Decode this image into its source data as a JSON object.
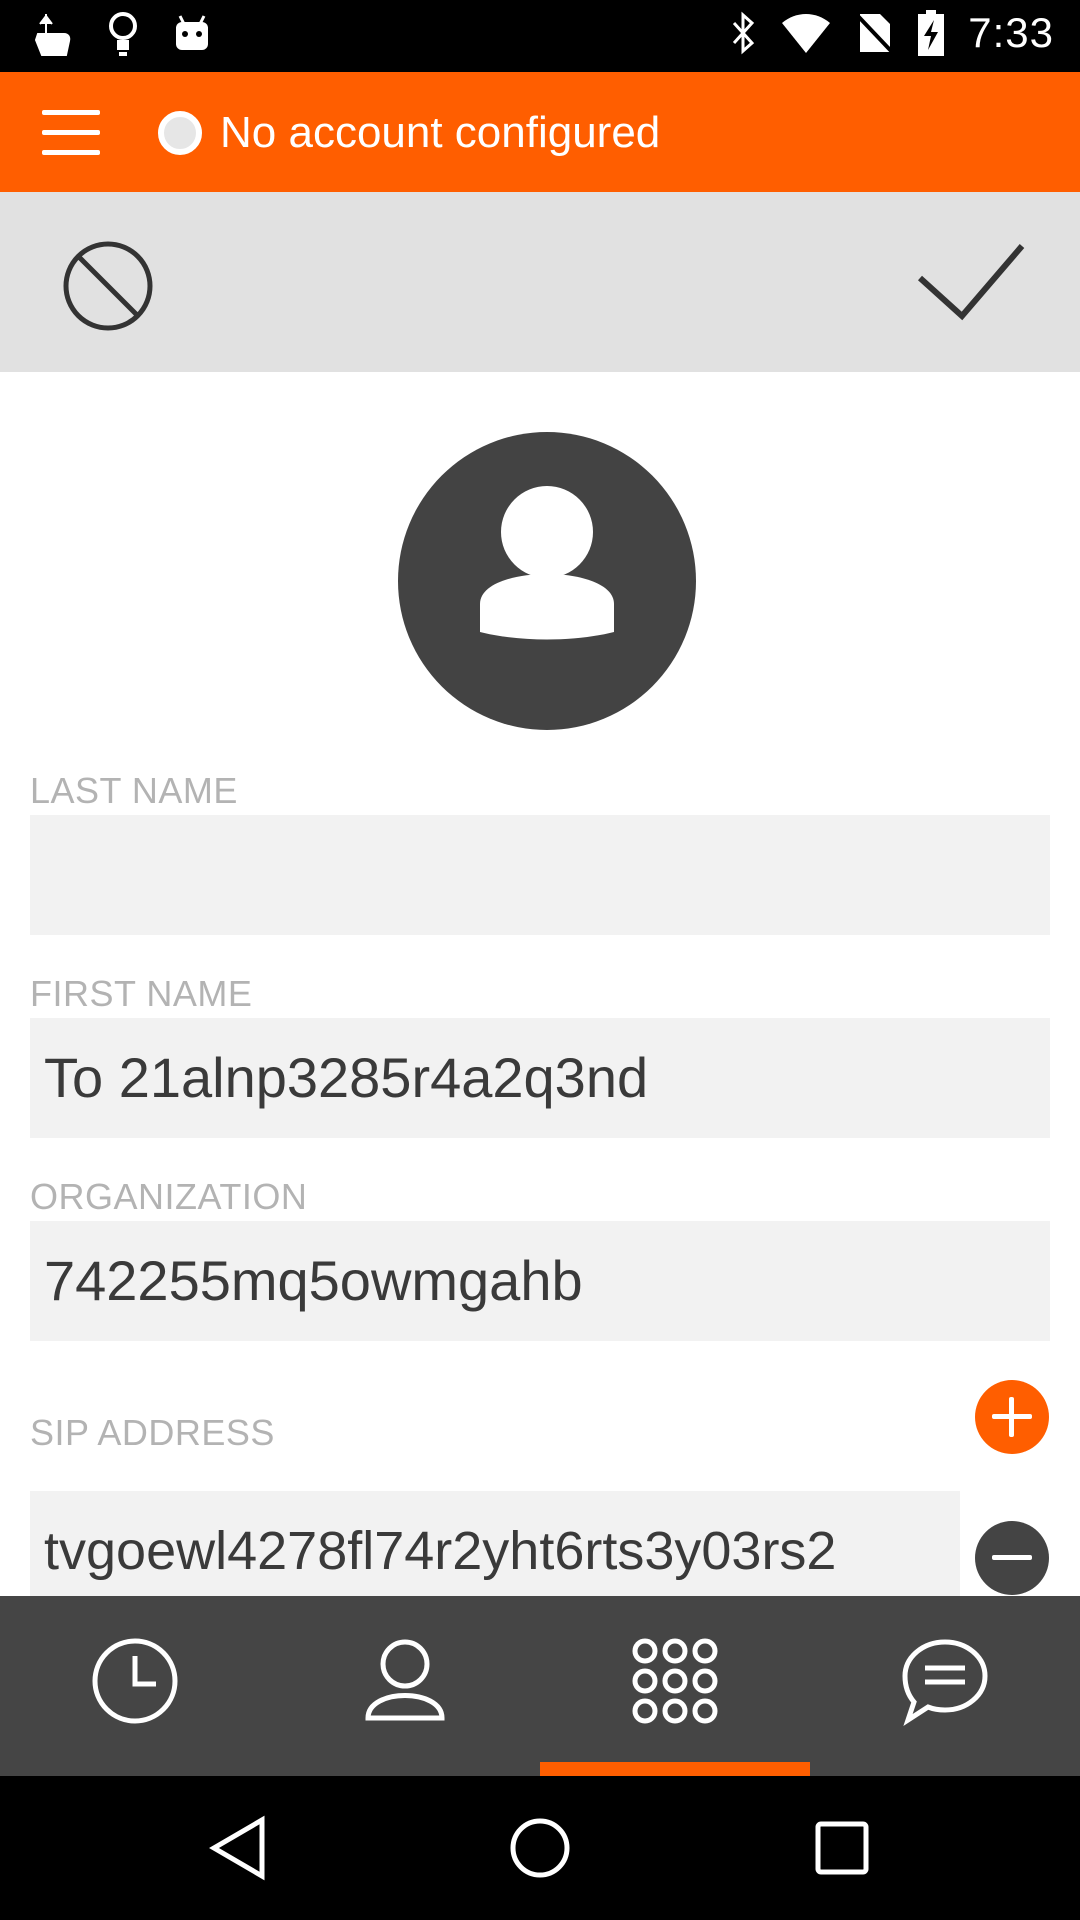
{
  "status_bar": {
    "time": "7:33",
    "left_icons": [
      "touch-gesture-icon",
      "lightbulb-icon",
      "android-robot-icon"
    ],
    "right_icons": [
      "bluetooth-icon",
      "wifi-icon",
      "no-sim-icon",
      "battery-charging-icon"
    ]
  },
  "app_bar": {
    "menu_icon": "hamburger-menu-icon",
    "presence_icon": "presence-status-icon",
    "title": "No account configured"
  },
  "action_bar": {
    "cancel_icon": "cancel-circle-slash-icon",
    "confirm_icon": "checkmark-icon"
  },
  "contact_form": {
    "avatar_icon": "contact-avatar-icon",
    "last_name": {
      "label": "LAST NAME",
      "value": ""
    },
    "first_name": {
      "label": "FIRST NAME",
      "value": "To 21alnp3285r4a2q3nd"
    },
    "organization": {
      "label": "ORGANIZATION",
      "value": "742255mq5owmgahb"
    },
    "sip_address": {
      "label": "SIP ADDRESS",
      "value": "tvgoewl4278fl74r2yht6rts3y03rs2",
      "add_icon": "add-circle-icon",
      "remove_icon": "remove-circle-icon"
    }
  },
  "tab_bar": {
    "tabs": [
      {
        "icon": "history-clock-icon",
        "selected": false
      },
      {
        "icon": "contacts-person-icon",
        "selected": false
      },
      {
        "icon": "dialpad-icon",
        "selected": true
      },
      {
        "icon": "chat-bubble-icon",
        "selected": false
      }
    ],
    "accent_color": "#ff5e00"
  },
  "nav_bar": {
    "buttons": [
      "back-triangle-icon",
      "home-circle-icon",
      "recents-square-icon"
    ]
  },
  "colors": {
    "brand": "#ff5e00",
    "action_bar_bg": "#e1e1e1",
    "tab_bar_bg": "#454545",
    "input_bg": "#f2f2f2",
    "label_text": "#b3b3b3"
  }
}
